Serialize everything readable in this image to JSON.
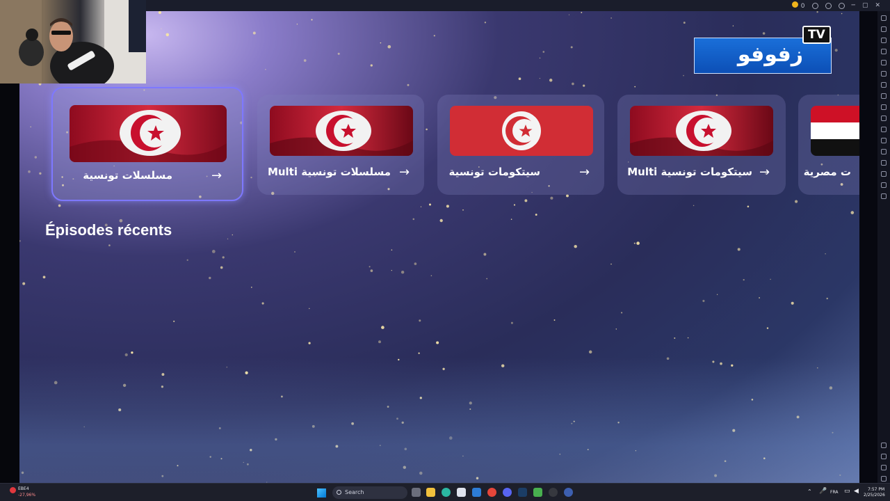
{
  "topbar": {
    "coins": "0"
  },
  "logo": {
    "text": "زفوفو",
    "badge": "TV"
  },
  "categories": [
    {
      "label": "مسلسلات تونسية",
      "arrow": "→",
      "flag": "tunisia-flag",
      "selected": true
    },
    {
      "label": "مسلسلات تونسية Multi",
      "arrow": "→",
      "flag": "tunisia-flag",
      "selected": false
    },
    {
      "label": "سيتكومات تونسية",
      "arrow": "→",
      "flag": "tunisia-flag",
      "selected": false
    },
    {
      "label": "سيتكومات تونسية Multi",
      "arrow": "→",
      "flag": "tunisia-flag",
      "selected": false
    },
    {
      "label": "ت مصرية",
      "arrow": "→",
      "flag": "egypt-flag",
      "selected": false
    }
  ],
  "section": {
    "title": "Épisodes récents"
  },
  "taskbar": {
    "search_placeholder": "Search",
    "stock_name": "EBE4",
    "stock_change": "-27,96%",
    "language": "FRA",
    "time": "7:57 PM",
    "date": "2/25/2026"
  },
  "colors": {
    "accent": "#7e78ff",
    "tunisia_red": "#c8102e",
    "logo_blue": "#1a6fd9"
  }
}
